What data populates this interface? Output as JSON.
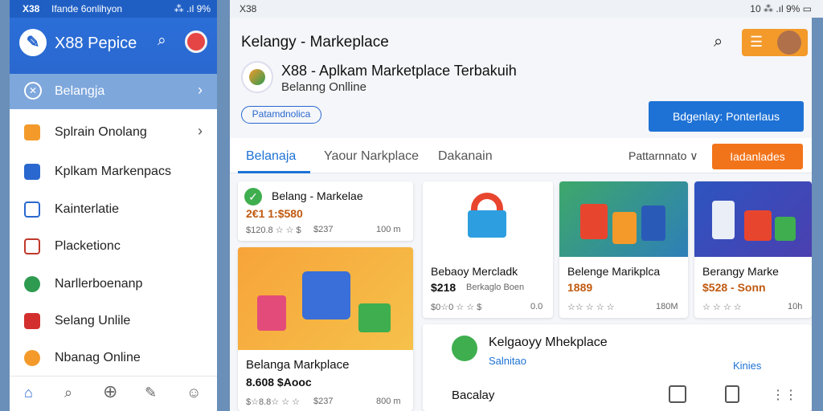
{
  "phone": {
    "status_time": "X38",
    "status_name": "Ifande 6onlihyon",
    "status_right": "⁂ .ıl 9%",
    "title": "X88 Pepice",
    "logo_glyph": "✎",
    "search_glyph": "⌕",
    "active_item": {
      "label": "Belangja",
      "icon_glyph": "✕",
      "chevron": "›"
    },
    "items": [
      {
        "label": "Splrain Onolang",
        "color": "#f39a2b",
        "chevron": "›"
      },
      {
        "label": "Kplkam Markenpacs",
        "color": "#2a68cf",
        "chevron": ""
      },
      {
        "label": "Kainterlatie",
        "color": "#2a68cf",
        "chevron": ""
      },
      {
        "label": "Placketionc",
        "color": "#c0392b",
        "chevron": ""
      },
      {
        "label": "Narllerboenanp",
        "color": "#2e9b50",
        "chevron": ""
      },
      {
        "label": "Selang Unlile",
        "color": "#d32f2f",
        "chevron": ""
      },
      {
        "label": "Nbanag Online",
        "color": "#f39a2b",
        "chevron": ""
      }
    ],
    "nav": [
      "⌂",
      "⌕",
      "⊕",
      "✎",
      "☺"
    ]
  },
  "tablet": {
    "status_time": "X38",
    "status_right": "10 ⁂ .ıl 9% ▭",
    "app_title": "Kelangy - Markeplace",
    "search_glyph": "⌕",
    "menu_glyph": "☰",
    "brand_name": "X88 - Aplkam Marketplace Terbakuih",
    "brand_sub": "Belanng Onlline",
    "brand_badge": "Patamdnolica",
    "cta": "Bdgenlay: Ponterlaus",
    "tabs": [
      "Belanaja",
      "Yaour Narkplace",
      "Dakanain"
    ],
    "sort": "Pattarnnato ∨",
    "filter": "Iadanlades"
  },
  "cards": {
    "c1": {
      "title": "Belang - Markelae",
      "price": "2€1 1:$580",
      "meta_left": "$120.8 ☆ ☆ $",
      "meta_mid": "$237",
      "meta_right": "100 m"
    },
    "c2": {
      "title": "Belanga Markplace",
      "price": "8.608 $Aooc",
      "meta_left": "$☆8.8☆ ☆ ☆",
      "meta_mid": "$237",
      "meta_right": "800 m"
    },
    "c3": {
      "title": "Bebaoy Mercladk",
      "price": "$218",
      "price_sub": "Berkaglo Boen",
      "meta_left": "$0☆0 ☆ ☆ $",
      "meta_right": "0.0"
    },
    "c4": {
      "title": "Belenge Marikplca",
      "price": "1889",
      "meta_left": "☆☆ ☆ ☆ ☆",
      "meta_right": "180M"
    },
    "c5": {
      "title": "Berangy Marke",
      "price": "$528 - Sonn",
      "meta_left": "☆ ☆ ☆ ☆",
      "meta_right": "10h"
    },
    "c6": {
      "title": "Kelgaoyy Mhekplace",
      "sub": "Salnitao",
      "link": "Kinies",
      "footer": "Bacalay"
    }
  }
}
